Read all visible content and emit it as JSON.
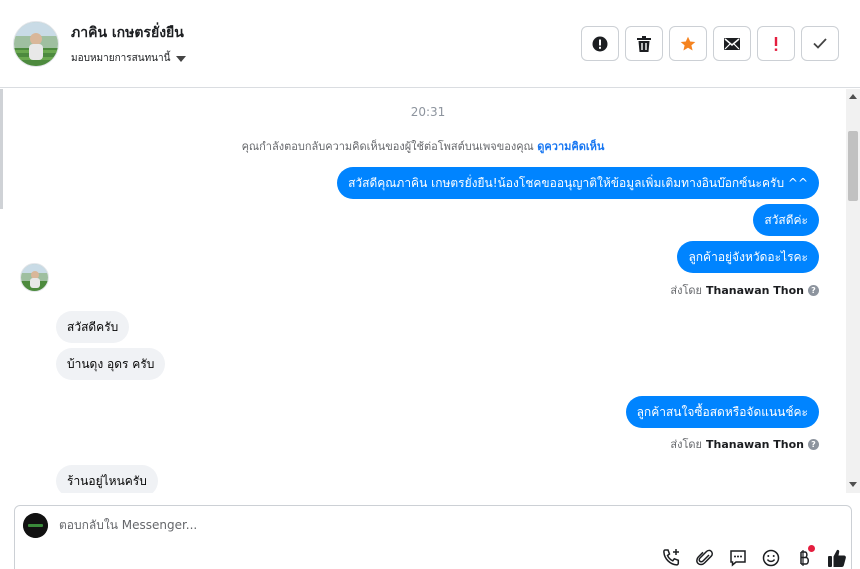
{
  "header": {
    "contact_name": "ภาคิน เกษตรยั่งยืน",
    "assign_label": "มอบหมายการสนทนานี้",
    "actions": [
      "mark-spam",
      "delete",
      "star",
      "mark-unread",
      "flag-important",
      "mark-done"
    ]
  },
  "thread": {
    "timestamp": "20:31",
    "notice_text": "คุณกำลังตอบกลับความคิดเห็นของผู้ใช้ต่อโพสต์บนเพจของคุณ",
    "notice_link": "ดูความคิดเห็น",
    "messages": [
      {
        "dir": "out",
        "text": "สวัสดีคุณภาคิน เกษตรยั่งยืน!น้องโชคขออนุญาติให้ข้อมูลเพิ่มเติมทางอินบ๊อกซ์นะครับ ^^"
      },
      {
        "dir": "out",
        "text": "สวัสดีค่ะ"
      },
      {
        "dir": "out",
        "text": "ลูกค้าอยู่จังหวัดอะไรคะ"
      },
      {
        "dir": "in",
        "text": "สวัสดีครับ"
      },
      {
        "dir": "in",
        "text": "บ้านดุง  อุดร ครับ"
      },
      {
        "dir": "out",
        "text": "ลูกค้าสนใจซื้อสดหรือจัดแนนช์คะ"
      },
      {
        "dir": "in",
        "text": "ร้านอยู่ไหนครับ"
      }
    ],
    "sent_by_prefix": "ส่งโดย",
    "sent_by_name": "Thanawan Thon"
  },
  "composer": {
    "placeholder": "ตอบกลับใน Messenger...",
    "tools": [
      "add-call-icon",
      "attachment-icon",
      "saved-reply-icon",
      "emoji-icon",
      "payment-icon",
      "like-icon"
    ],
    "colors": {
      "accent": "#0084ff",
      "link": "#1877f2",
      "alert": "#e41e3f",
      "star": "#f5831f"
    }
  }
}
